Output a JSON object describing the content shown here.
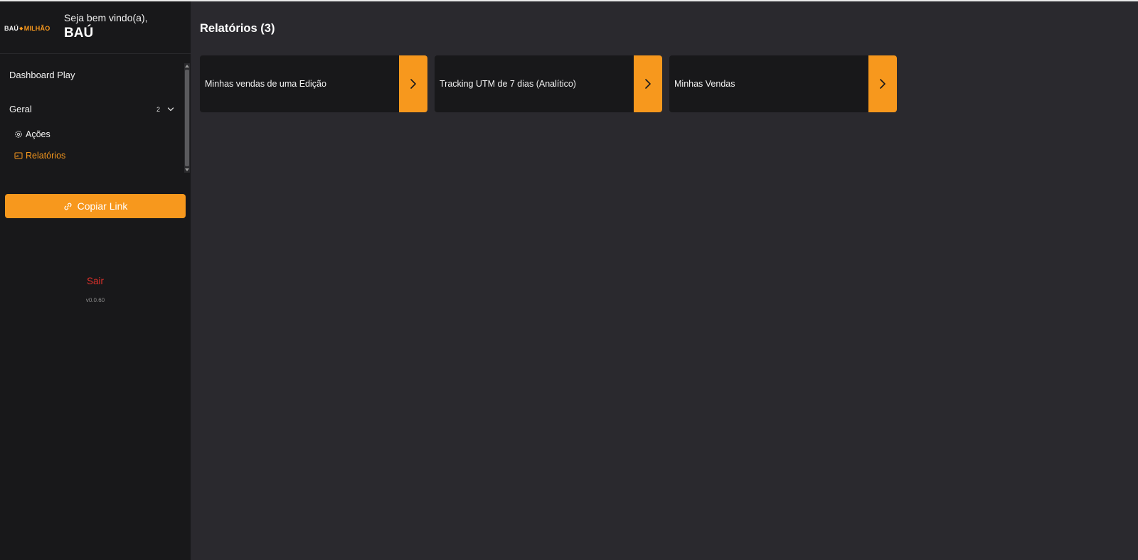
{
  "sidebar": {
    "logo": {
      "text_white": "BAÚ",
      "text_accent": "MILHÃO"
    },
    "greeting": "Seja bem vindo(a),",
    "user_name": "BAÚ",
    "nav_top": "Dashboard Play",
    "group": {
      "label": "Geral",
      "count": "2",
      "icon": "chevron-down-icon"
    },
    "sub_items": [
      {
        "label": "Ações",
        "icon": "gear-icon",
        "active": false
      },
      {
        "label": "Relatórios",
        "icon": "report-icon",
        "active": true
      }
    ],
    "copy_link": {
      "label": "Copiar Link",
      "icon": "link-icon"
    },
    "logout": "Sair",
    "version": "v0.0.60"
  },
  "main": {
    "title": "Relatórios (3)",
    "cards": [
      {
        "label": "Minhas vendas de uma Edição",
        "icon": "chevron-right-icon"
      },
      {
        "label": "Tracking UTM de 7 dias (Analítico)",
        "icon": "chevron-right-icon"
      },
      {
        "label": "Minhas Vendas",
        "icon": "chevron-right-icon"
      }
    ]
  },
  "colors": {
    "accent": "#f7981d",
    "sidebar_bg": "#18181a",
    "main_bg": "#2a292e",
    "card_bg": "#18181a",
    "logout": "#e0312a"
  }
}
